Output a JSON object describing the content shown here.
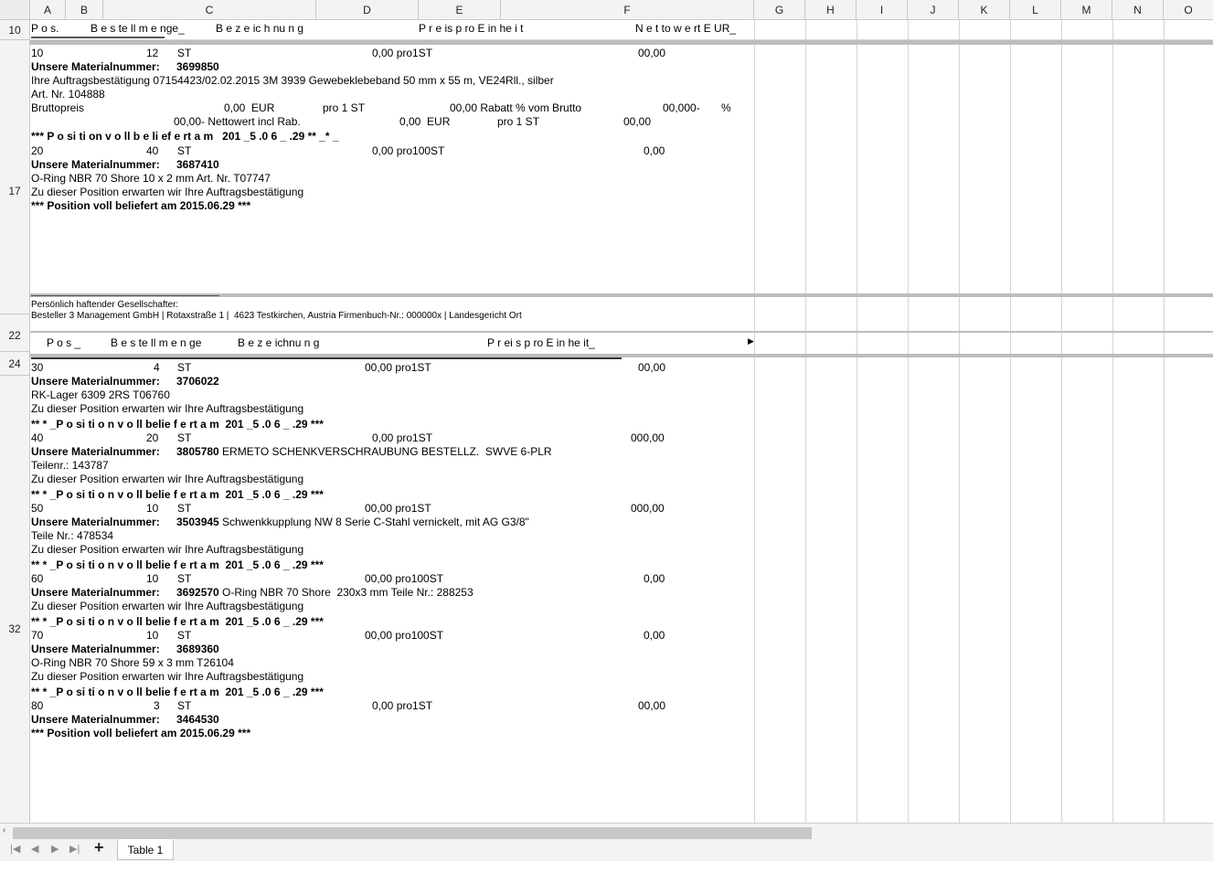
{
  "columns": [
    "A",
    "B",
    "C",
    "D",
    "E",
    "F",
    "G",
    "H",
    "I",
    "J",
    "K",
    "L",
    "M",
    "N",
    "O"
  ],
  "rows": [
    "10",
    "17",
    "22",
    "24",
    "32"
  ],
  "header1": {
    "pos": "P o s.",
    "menge": "B e s te ll m e nge_",
    "bez": "B e z e ic h nu n g",
    "preis": "P r e is p ro E in he i t",
    "netto": "N e t to w e rt E UR_"
  },
  "block1": [
    {
      "c1": "10",
      "c2": "12",
      "c3": "ST",
      "c4": "0,00 pro1ST",
      "c5": "00,00"
    },
    {
      "label": "Unsere Materialnummer:",
      "value": "3699850"
    },
    {
      "text": "Ihre Auftragsbestätigung 07154423/02.02.2015 3M 3939 Gewebeklebeband 50 mm x 55 m, VE24Rll., silber"
    },
    {
      "text": "Art. Nr. 104888"
    },
    {
      "brutto": "Bruttopreis",
      "bval": "0,00  EUR",
      "pro": "pro 1 ST",
      "rab": "00,00 Rabatt % vom Brutto",
      "rval": "00,000-",
      "pct": "%"
    },
    {
      "netto": "00,00- Nettowert incl Rab.",
      "nval": "0,00  EUR",
      "pro": "pro 1 ST",
      "nres": "00,00"
    },
    {
      "text": "*** P o si ti on v o ll b e li ef e rt a m   201 _5 .0 6 _ .29 ** _* _"
    },
    {
      "c1": "20",
      "c2": "40",
      "c3": "ST",
      "c4": "0,00 pro100ST",
      "c5": "0,00"
    },
    {
      "label": "Unsere Materialnummer:",
      "value": "3687410"
    },
    {
      "text": "O-Ring NBR 70 Shore 10 x 2 mm Art. Nr. T07747"
    },
    {
      "text": "Zu dieser Position erwarten wir Ihre Auftragsbestätigung"
    },
    {
      "text": "*** Position voll beliefert am 2015.06.29 ***"
    }
  ],
  "footer": {
    "line1": "Persönlich haftender Gesellschafter:",
    "line2": "Besteller 3 Management GmbH | Rotaxstraße 1 |  4623 Testkirchen, Austria Firmenbuch-Nr.: 000000x | Landesgericht Ort"
  },
  "header2": {
    "pos": "P o s _",
    "menge": "B e s te ll m e n ge",
    "bez": "B e z e ichnu n g",
    "preis": "P r ei s p ro E in he it_"
  },
  "block2": [
    {
      "c1": "30",
      "c2": "4",
      "c3": "ST",
      "c4": "00,00 pro1ST",
      "c5": "00,00"
    },
    {
      "label": "Unsere Materialnummer:",
      "value": "3706022"
    },
    {
      "text": "RK-Lager 6309 2RS T06760"
    },
    {
      "text": "Zu dieser Position erwarten wir Ihre Auftragsbestätigung"
    },
    {
      "text": "** * _P o si ti o n v o ll belie f e rt a m  201 _5 .0 6 _ .29 ***"
    },
    {
      "c1": "40",
      "c2": "20",
      "c3": "ST",
      "c4": "0,00 pro1ST",
      "c5": "000,00"
    },
    {
      "label": "Unsere Materialnummer:",
      "value": "3805780 ERMETO SCHENKVERSCHRAUBUNG BESTELLZ.  SWVE 6-PLR"
    },
    {
      "text": "Teilenr.: 143787"
    },
    {
      "text": "Zu dieser Position erwarten wir Ihre Auftragsbestätigung"
    },
    {
      "text": "** * _P o si ti o n v o ll belie f e rt a m  201 _5 .0 6 _ .29 ***"
    },
    {
      "c1": "50",
      "c2": "10",
      "c3": "ST",
      "c4": "00,00 pro1ST",
      "c5": "000,00"
    },
    {
      "label": "Unsere Materialnummer:",
      "value": "3503945 Schwenkkupplung NW 8 Serie C-Stahl vernickelt, mit AG G3/8\""
    },
    {
      "text": "Teile Nr.: 478534"
    },
    {
      "text": "Zu dieser Position erwarten wir Ihre Auftragsbestätigung"
    },
    {
      "text": "** * _P o si ti o n v o ll belie f e rt a m  201 _5 .0 6 _ .29 ***"
    },
    {
      "c1": "60",
      "c2": "10",
      "c3": "ST",
      "c4": "00,00 pro100ST",
      "c5": "0,00"
    },
    {
      "label": "Unsere Materialnummer:",
      "value": "3692570 O-Ring NBR 70 Shore  230x3 mm Teile Nr.: 288253"
    },
    {
      "text": "Zu dieser Position erwarten wir Ihre Auftragsbestätigung"
    },
    {
      "text": "** * _P o si ti o n v o ll belie f e rt a m  201 _5 .0 6 _ .29 ***"
    },
    {
      "c1": "70",
      "c2": "10",
      "c3": "ST",
      "c4": "00,00 pro100ST",
      "c5": "0,00"
    },
    {
      "label": "Unsere Materialnummer:",
      "value": "3689360"
    },
    {
      "text": "O-Ring NBR 70 Shore 59 x 3 mm T26104"
    },
    {
      "text": "Zu dieser Position erwarten wir Ihre Auftragsbestätigung"
    },
    {
      "text": "** * _P o si ti o n v o ll belie f e rt a m  201 _5 .0 6 _ .29 ***"
    },
    {
      "c1": "80",
      "c2": "3",
      "c3": "ST",
      "c4": "0,00 pro1ST",
      "c5": "00,00"
    },
    {
      "label": "Unsere Materialnummer:",
      "value": "3464530"
    },
    {
      "text": "*** Position voll beliefert am 2015.06.29 ***"
    }
  ],
  "sheet_tab": "Table 1",
  "add_sheet": "+"
}
